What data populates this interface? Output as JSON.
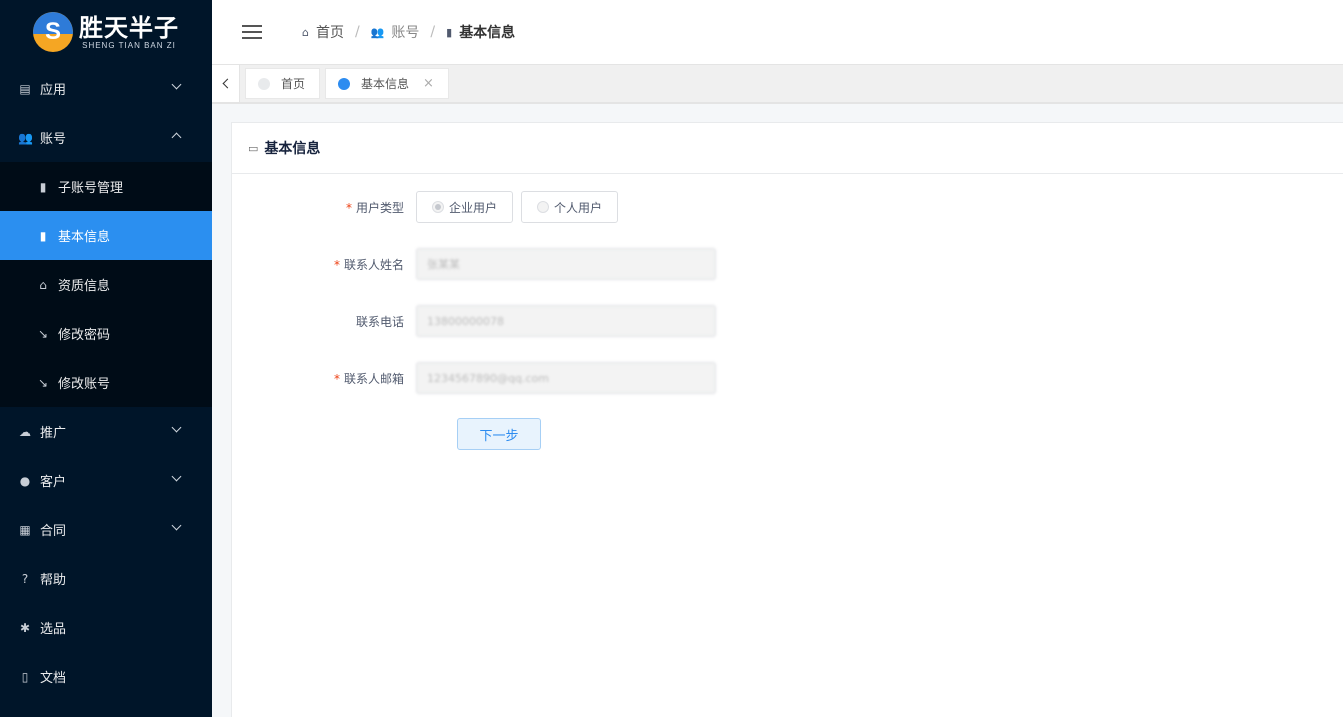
{
  "brand": {
    "title": "胜天半子",
    "subtitle": "SHENG TIAN   BAN ZI"
  },
  "sidebar": {
    "items": [
      {
        "label": "应用",
        "icon": "app-icon",
        "expandable": true,
        "expanded": false
      },
      {
        "label": "账号",
        "icon": "users-icon",
        "expandable": true,
        "expanded": true,
        "children": [
          {
            "label": "子账号管理",
            "icon": "document-icon"
          },
          {
            "label": "基本信息",
            "icon": "document-icon",
            "active": true
          },
          {
            "label": "资质信息",
            "icon": "home-icon"
          },
          {
            "label": "修改密码",
            "icon": "wrench-icon"
          },
          {
            "label": "修改账号",
            "icon": "wrench-icon"
          }
        ]
      },
      {
        "label": "推广",
        "icon": "cloud-upload-icon",
        "expandable": true,
        "expanded": false
      },
      {
        "label": "客户",
        "icon": "person-icon",
        "expandable": true,
        "expanded": false
      },
      {
        "label": "合同",
        "icon": "contract-icon",
        "expandable": true,
        "expanded": false
      },
      {
        "label": "帮助",
        "icon": "help-icon",
        "expandable": false
      },
      {
        "label": "选品",
        "icon": "gear-icon",
        "expandable": false
      },
      {
        "label": "文档",
        "icon": "book-icon",
        "expandable": false
      }
    ]
  },
  "header": {
    "breadcrumb": [
      {
        "label": "首页",
        "icon": "home-icon"
      },
      {
        "label": "账号",
        "icon": "users-icon"
      },
      {
        "label": "基本信息",
        "icon": "document-icon"
      }
    ]
  },
  "tabs": [
    {
      "label": "首页",
      "active": false,
      "closable": false
    },
    {
      "label": "基本信息",
      "active": true,
      "closable": true,
      "close_glyph": "×"
    }
  ],
  "card": {
    "title": "基本信息",
    "form": {
      "user_type": {
        "label": "用户类型",
        "required": true,
        "options": [
          "企业用户",
          "个人用户"
        ],
        "selected": "企业用户"
      },
      "contact_name": {
        "label": "联系人姓名",
        "required": true,
        "value": "张某某"
      },
      "contact_phone": {
        "label": "联系电话",
        "required": false,
        "value": "13800000078"
      },
      "contact_email": {
        "label": "联系人邮箱",
        "required": true,
        "value": "1234567890@qq.com"
      }
    },
    "next_button": "下一步"
  },
  "colors": {
    "sidebar_bg": "#001529",
    "submenu_bg": "#000c17",
    "active_item": "#2b8ff0",
    "required_star": "#ed4014",
    "primary": "#2d8cf0"
  }
}
